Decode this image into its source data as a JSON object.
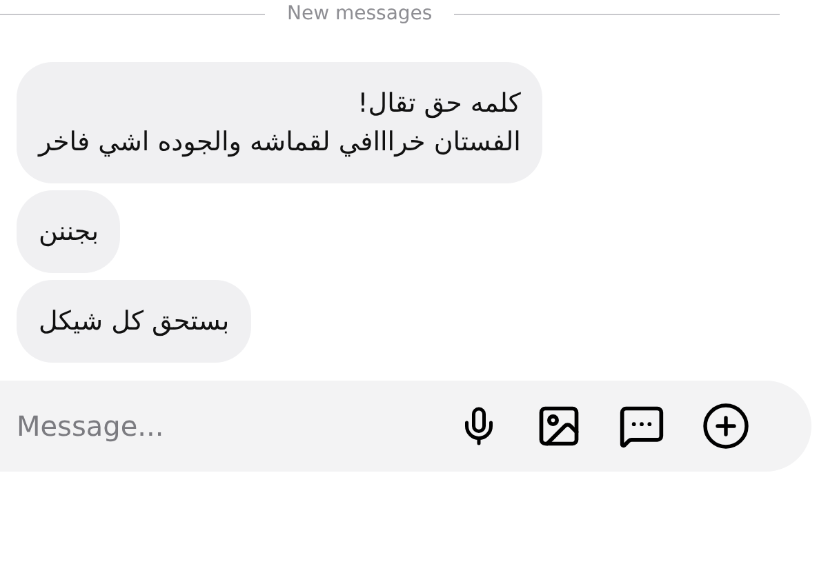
{
  "divider": {
    "label": "New messages"
  },
  "messages": [
    {
      "lines": [
        "كلمه حق تقال!",
        "الفستان خرااافي لقماشه والجوده اشي فاخر"
      ]
    },
    {
      "lines": [
        "بجننن"
      ]
    },
    {
      "lines": [
        "بستحق كل شيكل"
      ]
    }
  ],
  "composer": {
    "placeholder": "Message..."
  }
}
